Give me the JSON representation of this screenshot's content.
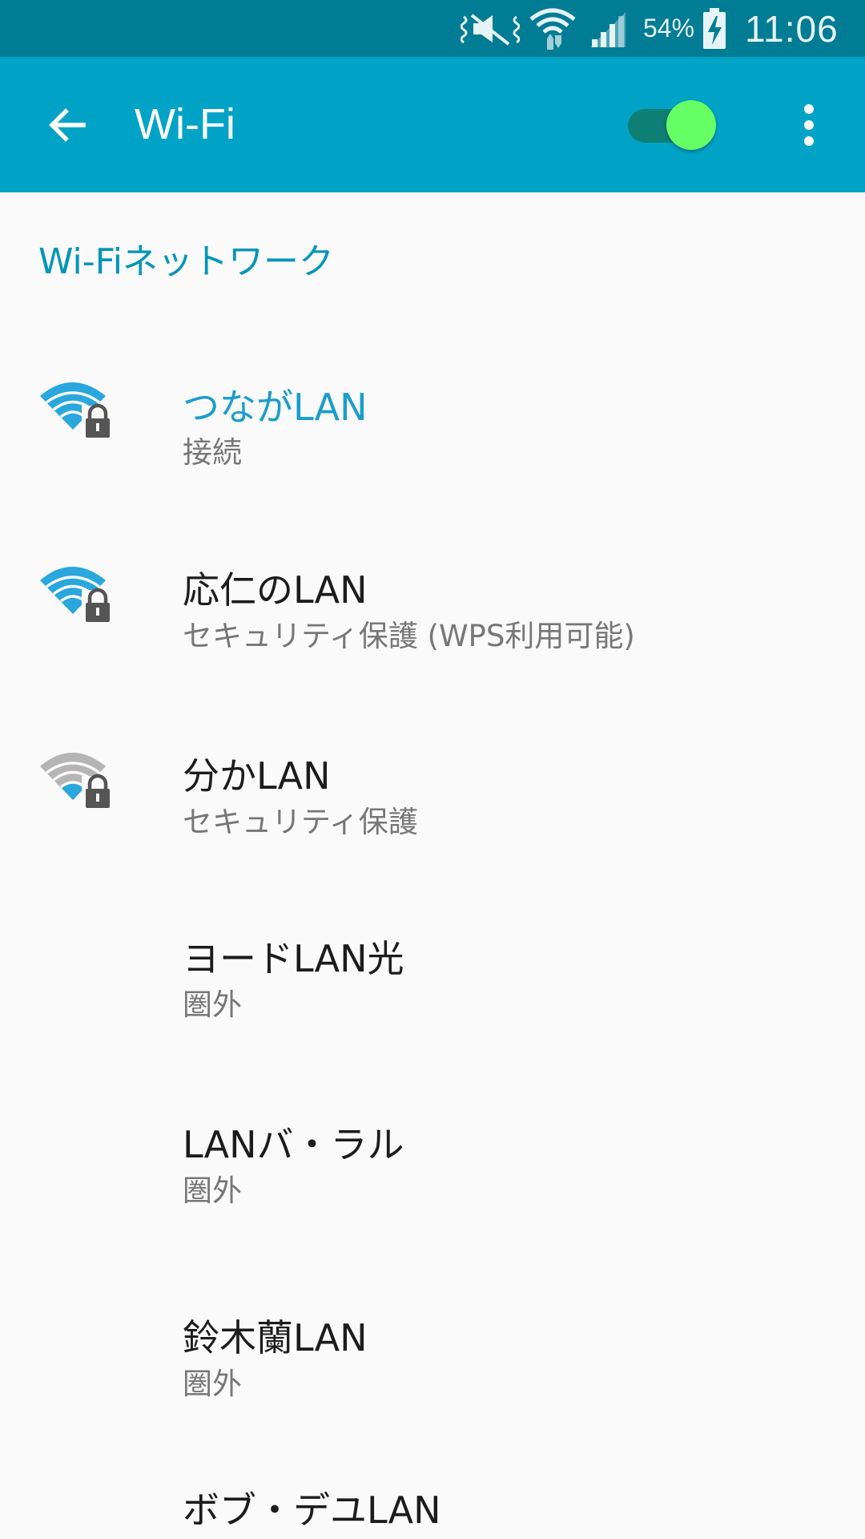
{
  "status_bar": {
    "battery_percent": "54%",
    "time": "11:06",
    "icons": [
      "vibrate-mute-icon",
      "wifi-data-icon",
      "cell-signal-icon",
      "battery-charging-icon"
    ]
  },
  "app_bar": {
    "title": "Wi-Fi",
    "wifi_enabled": true,
    "colors": {
      "bar": "#00a3c6",
      "status": "#007c94",
      "toggle_thumb": "#66ff66"
    }
  },
  "section": {
    "header": "Wi-Fiネットワーク"
  },
  "networks": [
    {
      "name": "つながLAN",
      "status": "接続",
      "connected": true,
      "signal": "strong",
      "secured": true
    },
    {
      "name": "応仁のLAN",
      "status": "セキュリティ保護 (WPS利用可能)",
      "connected": false,
      "signal": "strong",
      "secured": true
    },
    {
      "name": "分かLAN",
      "status": "セキュリティ保護",
      "connected": false,
      "signal": "weak",
      "secured": true
    },
    {
      "name": "ヨードLAN光",
      "status": "圏外",
      "connected": false,
      "signal": "none",
      "secured": false
    },
    {
      "name": "LANバ・ラル",
      "status": "圏外",
      "connected": false,
      "signal": "none",
      "secured": false
    },
    {
      "name": "鈴木蘭LAN",
      "status": "圏外",
      "connected": false,
      "signal": "none",
      "secured": false
    },
    {
      "name": "ボブ・デユLAN",
      "status": "",
      "connected": false,
      "signal": "none",
      "secured": false
    }
  ]
}
